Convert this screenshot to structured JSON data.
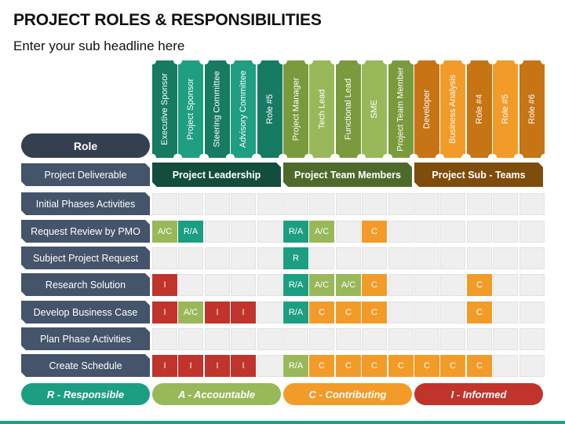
{
  "title": "PROJECT ROLES & RESPONSIBILITIES",
  "subtitle": "Enter your sub headline here",
  "role_header": "Role",
  "colors": {
    "R": "#1c9e82",
    "A": "#98b85a",
    "C": "#f29b29",
    "I": "#c0342c",
    "row_label": "#44546a",
    "role_pill": "#343f4f",
    "empty_cell": "#efefef"
  },
  "groups": [
    {
      "label": "Project Leadership",
      "color": "#124d3e",
      "columns": [
        {
          "label": "Executive Sponsor",
          "color": "#177a62"
        },
        {
          "label": "Project Sponsor",
          "color": "#1f9e82"
        },
        {
          "label": "Steering Committee",
          "color": "#177a62"
        },
        {
          "label": "Advisory Committee",
          "color": "#1f9e82"
        },
        {
          "label": "Role #5",
          "color": "#177a62"
        }
      ]
    },
    {
      "label": "Project Team Members",
      "color": "#4d6a2a",
      "columns": [
        {
          "label": "Project Manager",
          "color": "#7a9a3e"
        },
        {
          "label": "Tech Lead",
          "color": "#98b85a"
        },
        {
          "label": "Functional Lead",
          "color": "#7a9a3e"
        },
        {
          "label": "SME",
          "color": "#98b85a"
        },
        {
          "label": "Project Team Member",
          "color": "#7a9a3e"
        }
      ]
    },
    {
      "label": "Project Sub - Teams",
      "color": "#7e4c0b",
      "columns": [
        {
          "label": "Developer",
          "color": "#c67414"
        },
        {
          "label": "Business Analysis",
          "color": "#f29b29"
        },
        {
          "label": "Role #4",
          "color": "#c67414"
        },
        {
          "label": "Role #5",
          "color": "#f29b29"
        },
        {
          "label": "Role #6",
          "color": "#c67414"
        }
      ]
    }
  ],
  "deliverable_label": "Project Deliverable",
  "rows": [
    {
      "label": "Initial Phases Activities",
      "cells": [
        "",
        "",
        "",
        "",
        "",
        "",
        "",
        "",
        "",
        "",
        "",
        "",
        "",
        "",
        ""
      ]
    },
    {
      "label": "Request Review by PMO",
      "cells": [
        "A/C",
        "R/A",
        "",
        "",
        "",
        "R/A",
        "A/C",
        "",
        "C",
        "",
        "",
        "",
        "",
        "",
        ""
      ]
    },
    {
      "label": "Subject Project Request",
      "cells": [
        "",
        "",
        "",
        "",
        "",
        "R",
        "",
        "",
        "",
        "",
        "",
        "",
        "",
        "",
        ""
      ]
    },
    {
      "label": "Research Solution",
      "cells": [
        "I",
        "",
        "",
        "",
        "",
        "R/A",
        "A/C",
        "A/C",
        "C",
        "",
        "",
        "",
        "C",
        "",
        ""
      ]
    },
    {
      "label": "Develop Business Case",
      "cells": [
        "I",
        "A/C",
        "I",
        "I",
        "",
        "R/A",
        "C",
        "C",
        "C",
        "",
        "",
        "",
        "C",
        "",
        ""
      ]
    },
    {
      "label": "Plan Phase Activities",
      "cells": [
        "",
        "",
        "",
        "",
        "",
        "",
        "",
        "",
        "",
        "",
        "",
        "",
        "",
        "",
        ""
      ]
    },
    {
      "label": "Create Schedule",
      "cells": [
        "I",
        "I",
        "I",
        "I",
        "",
        "R/A*",
        "C",
        "C",
        "C",
        "C",
        "C",
        "C",
        "C",
        "",
        ""
      ]
    }
  ],
  "legend": [
    {
      "label": "R - Responsible",
      "color": "#1c9e82"
    },
    {
      "label": "A - Accountable",
      "color": "#98b85a"
    },
    {
      "label": "C - Contributing",
      "color": "#f29b29"
    },
    {
      "label": "I - Informed",
      "color": "#c0342c"
    }
  ]
}
